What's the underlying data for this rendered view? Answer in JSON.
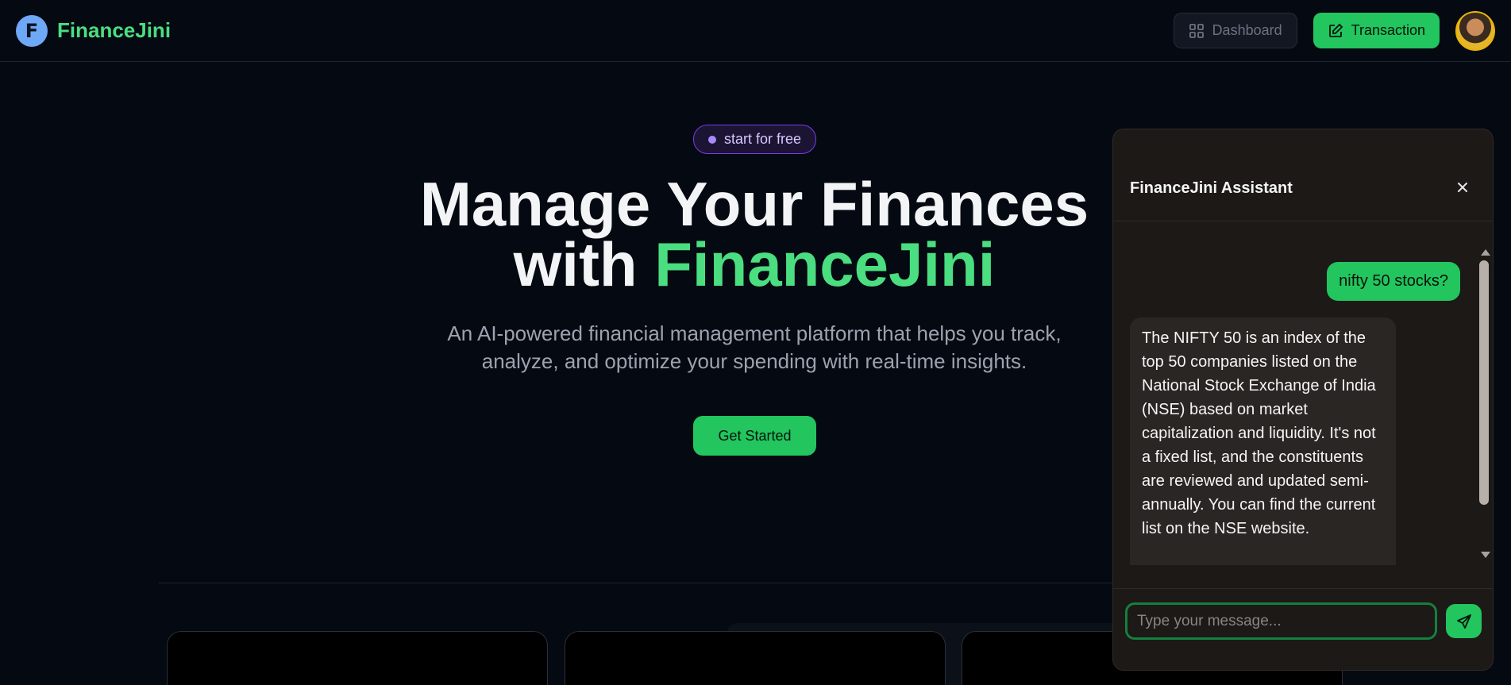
{
  "app": {
    "brand": "FinanceJini",
    "logo_letter": "F"
  },
  "header": {
    "dashboard_label": "Dashboard",
    "transaction_label": "Transaction"
  },
  "hero": {
    "badge": "start for free",
    "title_line1": "Manage Your Finances",
    "title_with": "with",
    "title_accent": "FinanceJini",
    "subtitle": "An AI-powered financial management platform that helps you track, analyze, and optimize your spending with real-time insights.",
    "cta": "Get Started"
  },
  "chat": {
    "title": "FinanceJini Assistant",
    "messages": [
      {
        "role": "user",
        "text": "nifty 50 stocks?"
      },
      {
        "role": "assistant",
        "text": "The NIFTY 50 is an index of the top 50 companies listed on the National Stock Exchange of India (NSE) based on market capitalization and liquidity. It's not a fixed list, and the constituents are reviewed and updated semi-annually. You can find the current list on the NSE website."
      }
    ],
    "input_value": "",
    "input_placeholder": "Type your message..."
  },
  "colors": {
    "accent": "#22c55e",
    "brand_text": "#4ade80",
    "background": "#050912",
    "chat_bg": "#1c1917"
  },
  "icons": {
    "logo": "finance-f-logo-icon",
    "dashboard": "grid-icon",
    "transaction": "pen-square-icon",
    "close": "close-icon",
    "send": "send-icon"
  }
}
